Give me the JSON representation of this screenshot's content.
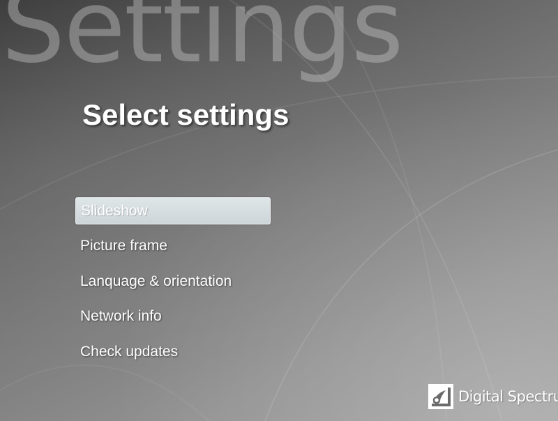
{
  "watermark": {
    "text": "Settings"
  },
  "header": {
    "title": "Select settings"
  },
  "menu": {
    "selected_index": 0,
    "items": [
      {
        "label": "Slideshow"
      },
      {
        "label": "Picture frame"
      },
      {
        "label": "Lanquage & orientation"
      },
      {
        "label": "Network info"
      },
      {
        "label": "Check updates"
      }
    ]
  },
  "brand": {
    "logo_icon": "digital-spectrum-logo-icon",
    "name": "Digital Spectrum"
  },
  "colors": {
    "text": "#ffffff",
    "selection_bg": "#d6dde0",
    "selection_border": "#f2f5f6"
  }
}
